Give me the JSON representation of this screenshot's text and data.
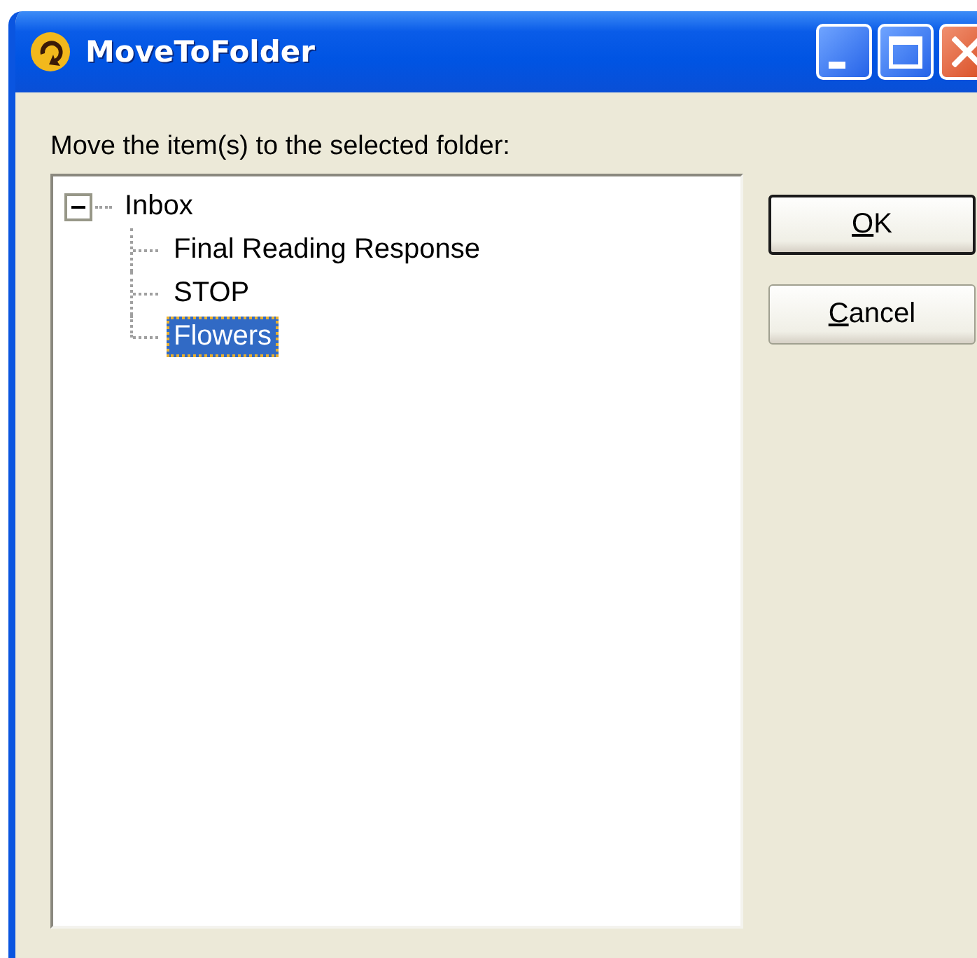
{
  "window": {
    "title": "MoveToFolder"
  },
  "prompt": "Move the item(s) to the selected folder:",
  "tree": [
    {
      "label": "Inbox",
      "expanded": true,
      "selected": false,
      "children": [
        {
          "label": "Final Reading Response",
          "selected": false
        },
        {
          "label": "STOP",
          "selected": false
        },
        {
          "label": "Flowers",
          "selected": true
        }
      ]
    }
  ],
  "buttons": [
    {
      "label": "OK",
      "default": true,
      "underline_first": true
    },
    {
      "label": "Cancel",
      "default": false,
      "underline_first": true
    }
  ]
}
